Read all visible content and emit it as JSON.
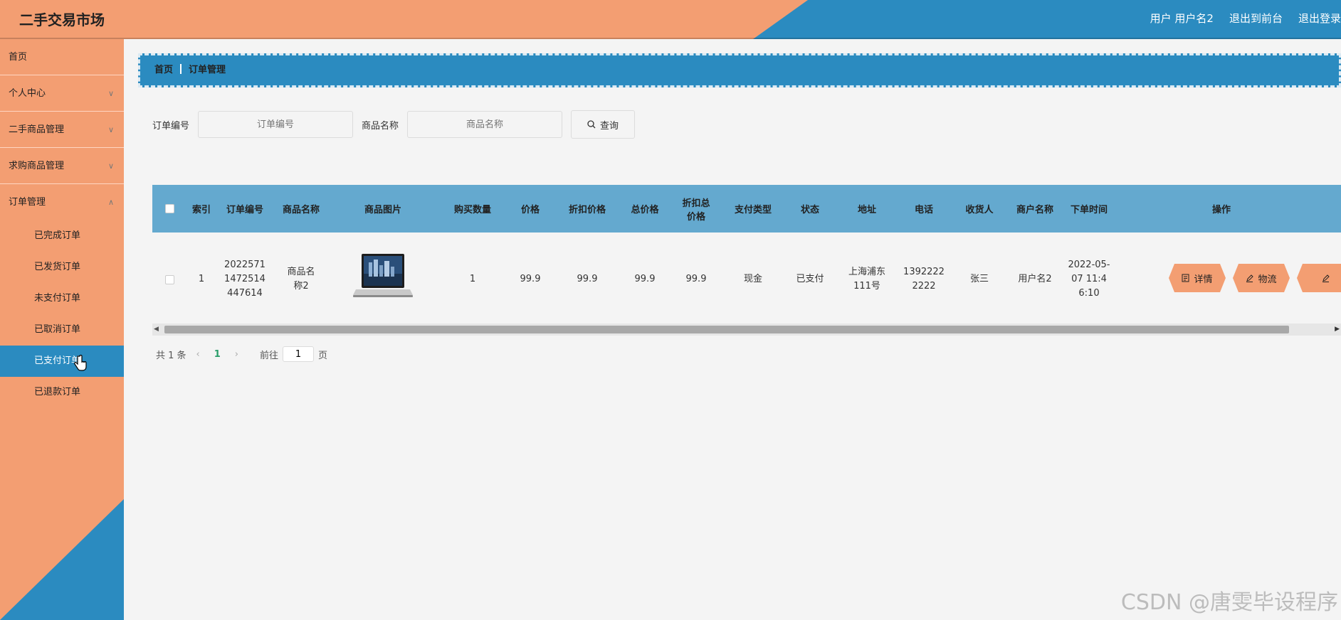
{
  "header": {
    "title": "二手交易市场",
    "user_label": "用户 用户名2",
    "exit_front": "退出到前台",
    "logout": "退出登录"
  },
  "sidebar": {
    "items": [
      {
        "label": "首页"
      },
      {
        "label": "个人中心"
      },
      {
        "label": "二手商品管理"
      },
      {
        "label": "求购商品管理"
      },
      {
        "label": "订单管理"
      }
    ],
    "subitems": [
      {
        "label": "已完成订单"
      },
      {
        "label": "已发货订单"
      },
      {
        "label": "未支付订单"
      },
      {
        "label": "已取消订单"
      },
      {
        "label": "已支付订单",
        "active": true
      },
      {
        "label": "已退款订单"
      }
    ]
  },
  "breadcrumb": {
    "home": "首页",
    "current": "订单管理"
  },
  "search": {
    "order_no_label": "订单编号",
    "order_no_placeholder": "订单编号",
    "product_name_label": "商品名称",
    "product_name_placeholder": "商品名称",
    "query_button": "查询"
  },
  "table": {
    "headers": {
      "index": "索引",
      "order_no": "订单编号",
      "product_name": "商品名称",
      "product_image": "商品图片",
      "quantity": "购买数量",
      "price": "价格",
      "discount_price": "折扣价格",
      "total_price": "总价格",
      "discount_total": "折扣总价格",
      "pay_type": "支付类型",
      "status": "状态",
      "address": "地址",
      "phone": "电话",
      "receiver": "收货人",
      "merchant": "商户名称",
      "order_time": "下单时间",
      "actions": "操作"
    },
    "rows": [
      {
        "index": "1",
        "order_no": "20225711472514447614",
        "product_name": "商品名称2",
        "quantity": "1",
        "price": "99.9",
        "discount_price": "99.9",
        "total_price": "99.9",
        "discount_total": "99.9",
        "pay_type": "现金",
        "status": "已支付",
        "address": "上海浦东111号",
        "phone": "13922222222",
        "receiver": "张三",
        "merchant": "用户名2",
        "order_time": "2022-05-07 11:46:10"
      }
    ],
    "actions": {
      "detail": "详情",
      "logistics": "物流"
    }
  },
  "pagination": {
    "total": "共 1 条",
    "current_page": "1",
    "goto_label": "前往",
    "goto_value": "1",
    "page_suffix": "页"
  },
  "watermark": "CSDN @唐雯毕设程序",
  "colors": {
    "orange": "#f39e72",
    "blue": "#2b8bc0",
    "table_head": "#64a9cf"
  }
}
